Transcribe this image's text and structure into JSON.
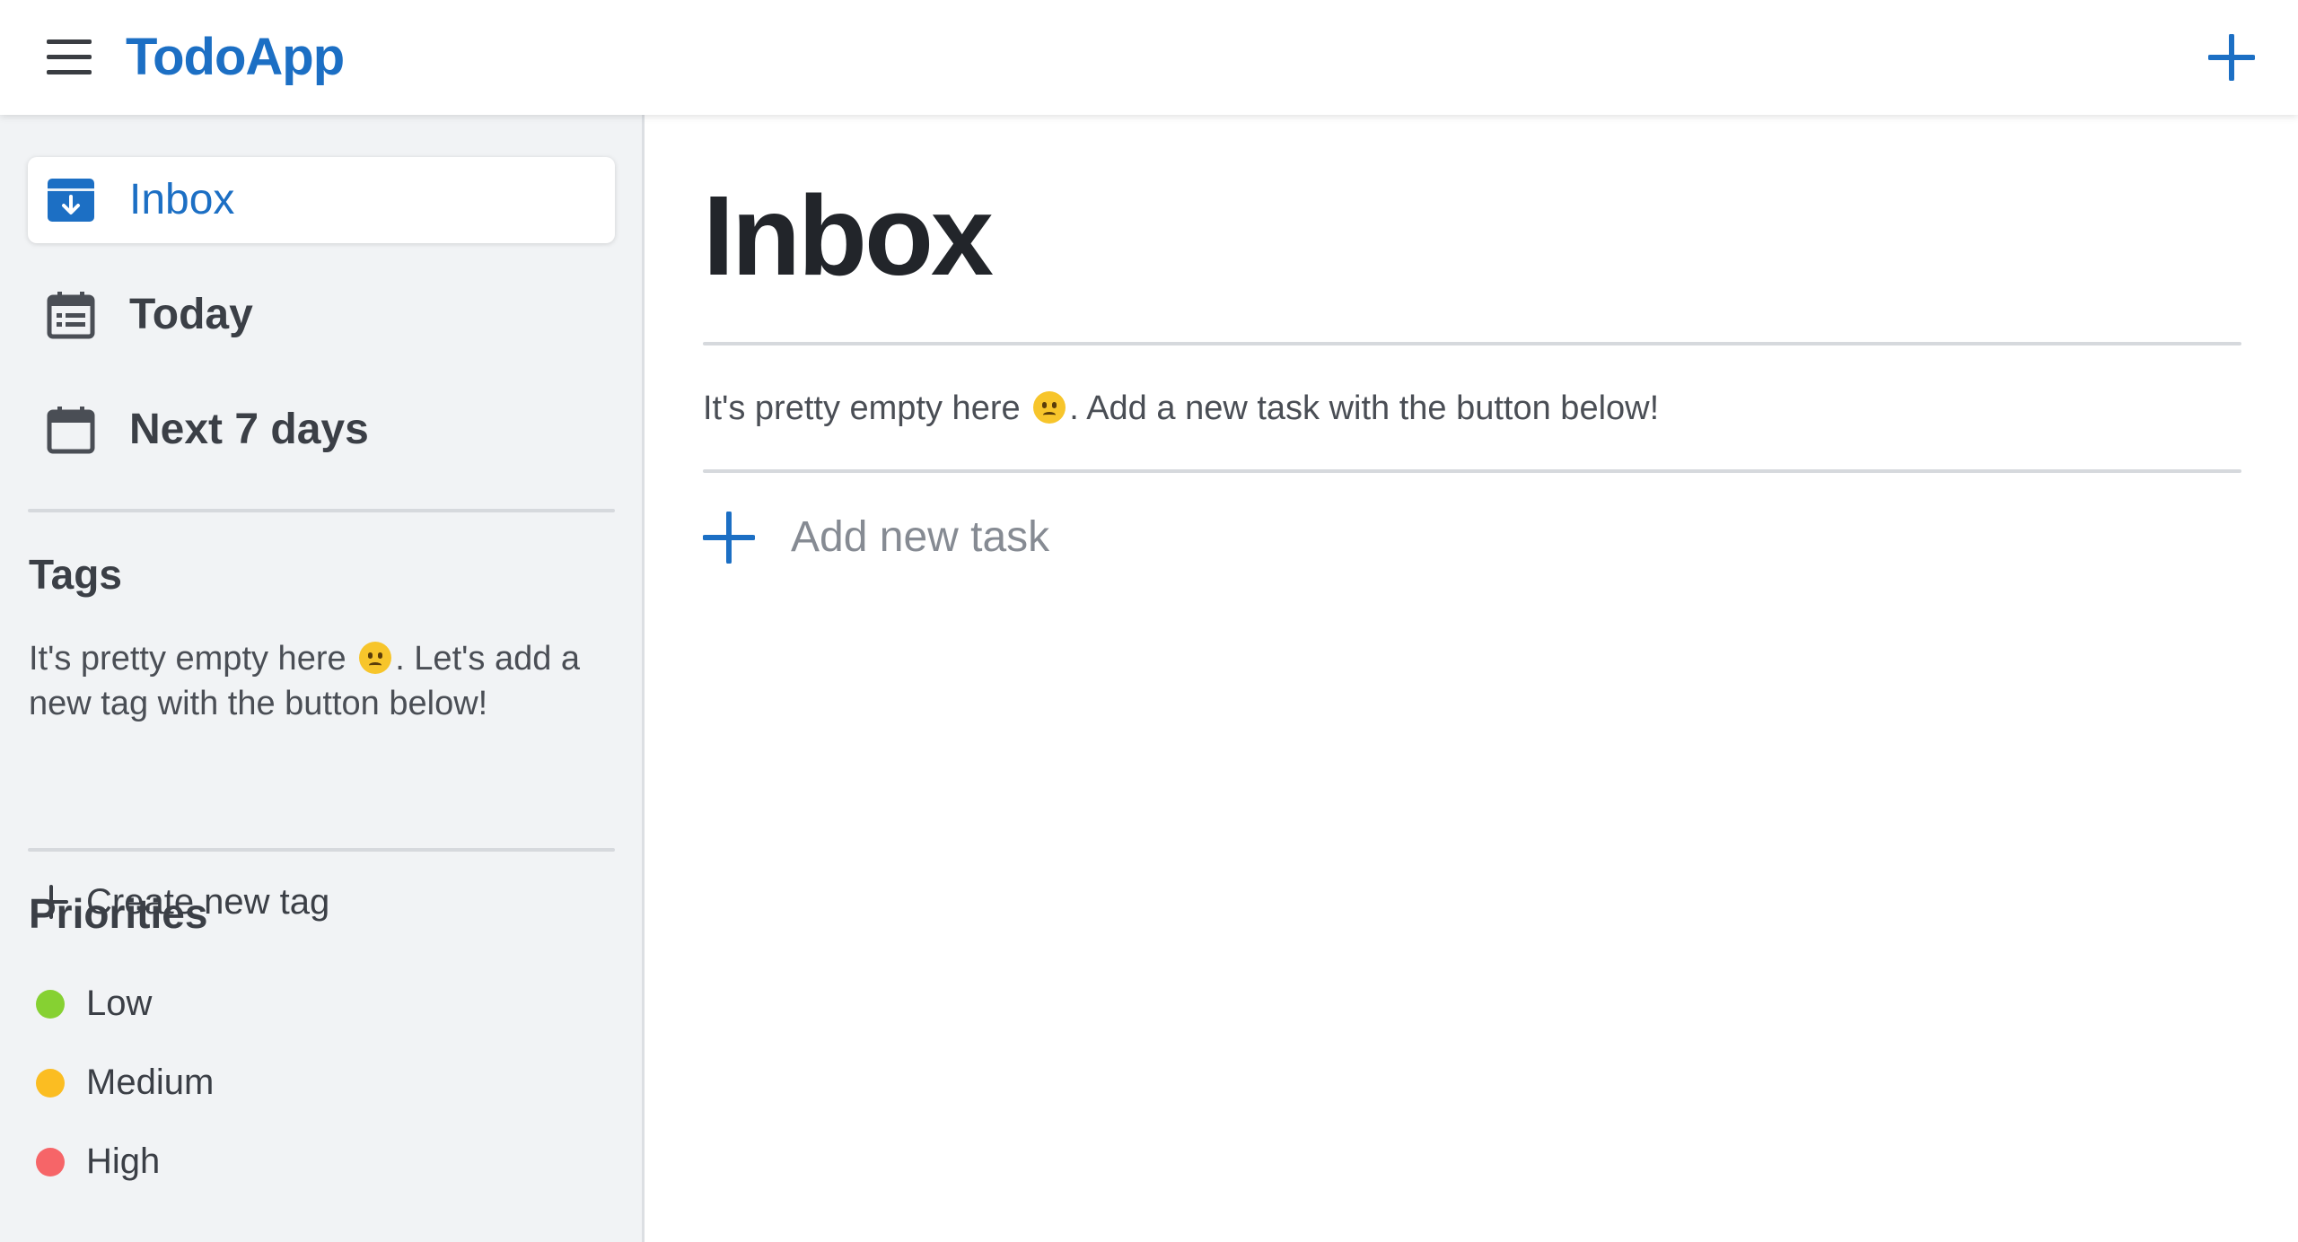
{
  "app": {
    "title": "TodoApp"
  },
  "header": {
    "menu_icon": "hamburger-icon",
    "add_icon": "plus-icon"
  },
  "sidebar": {
    "nav": [
      {
        "label": "Inbox",
        "icon": "inbox-icon",
        "active": true
      },
      {
        "label": "Today",
        "icon": "calendar-list-icon",
        "active": false
      },
      {
        "label": "Next 7 days",
        "icon": "calendar-icon",
        "active": false
      }
    ],
    "tags": {
      "title": "Tags",
      "empty_before": "It's pretty empty here",
      "empty_after": ". Let's add a new tag with the button below!",
      "create_label": "Create new tag"
    },
    "priorities": {
      "title": "Priorities",
      "items": [
        {
          "label": "Low",
          "color": "#86d132"
        },
        {
          "label": "Medium",
          "color": "#fbbd22"
        },
        {
          "label": "High",
          "color": "#f66568"
        }
      ]
    }
  },
  "main": {
    "title": "Inbox",
    "empty_before": "It's pretty empty here",
    "empty_after": ". Add a new task with the button below!",
    "add_task_label": "Add new task"
  },
  "colors": {
    "accent": "#1c6fc4",
    "sidebar_bg": "#f1f3f5"
  }
}
